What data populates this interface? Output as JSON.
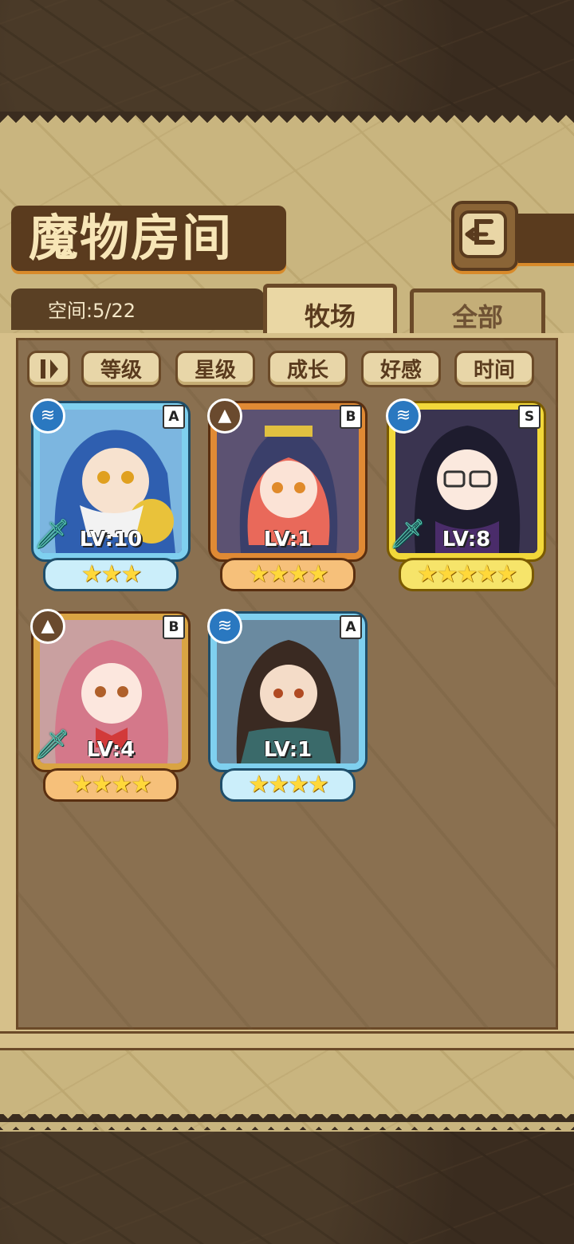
{
  "header": {
    "title": "魔物房间"
  },
  "space": {
    "label": "空间:5/22"
  },
  "tabs": [
    {
      "label": "牧场",
      "active": true
    },
    {
      "label": "全部",
      "active": false
    }
  ],
  "filters": [
    "等级",
    "星级",
    "成长",
    "好感",
    "时间"
  ],
  "monsters": [
    {
      "grade": "A",
      "element": "water",
      "level": "LV:10",
      "stars": 3
    },
    {
      "grade": "B",
      "element": "earth",
      "level": "LV:1",
      "stars": 4
    },
    {
      "grade": "S",
      "element": "water",
      "level": "LV:8",
      "stars": 5
    },
    {
      "grade": "B",
      "element": "earth",
      "level": "LV:4",
      "stars": 4
    },
    {
      "grade": "A",
      "element": "water",
      "level": "LV:1",
      "stars": 4
    }
  ],
  "colors": {
    "parchment": "#c9b57f",
    "panel": "#8a7050",
    "accent": "#d88a2a"
  }
}
